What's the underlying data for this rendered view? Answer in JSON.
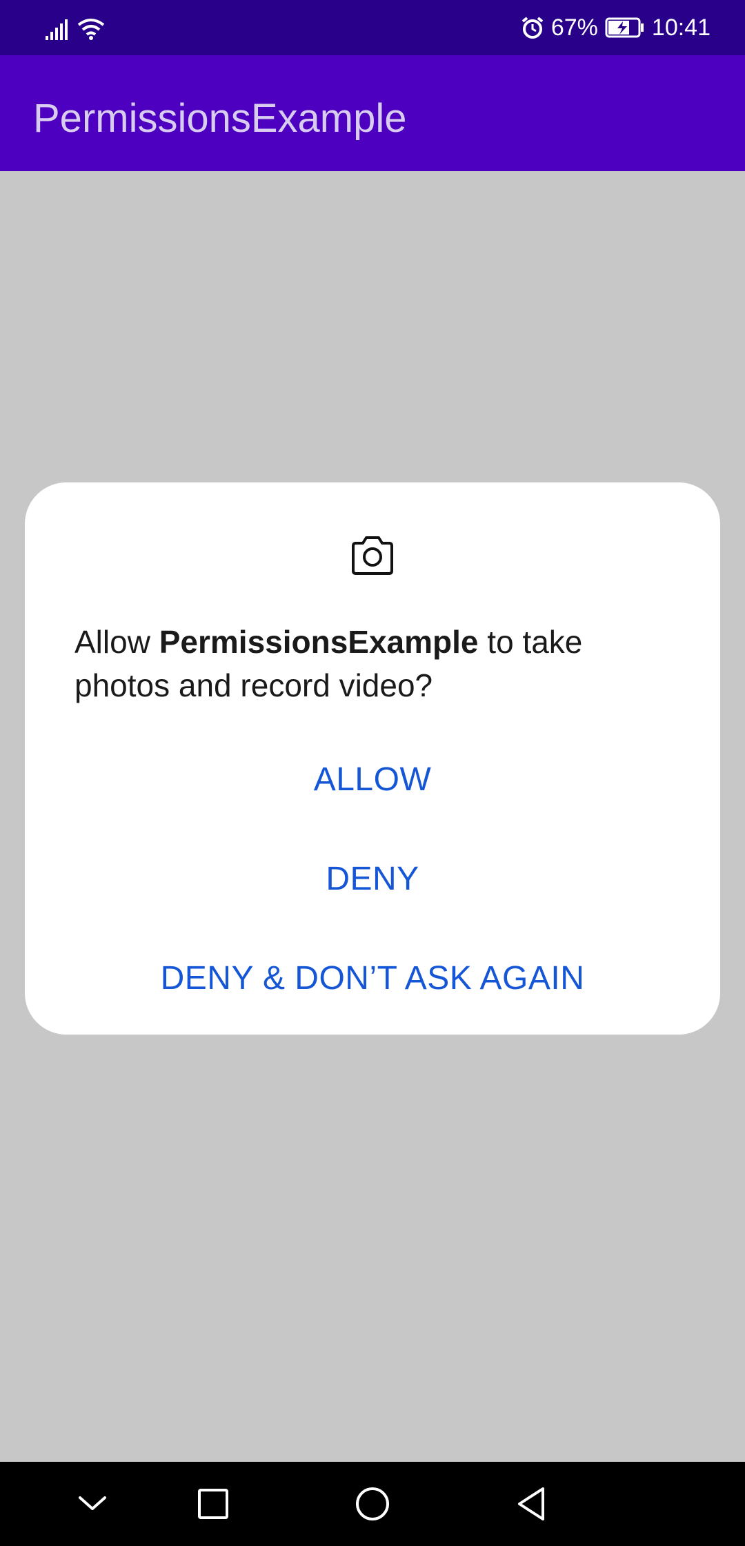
{
  "status_bar": {
    "battery_percent": "67%",
    "time": "10:41",
    "icons": [
      "signal-icon",
      "wifi-icon",
      "alarm-icon",
      "battery-charging-icon"
    ]
  },
  "app_bar": {
    "title": "PermissionsExample"
  },
  "dialog": {
    "icon": "camera-icon",
    "message_prefix": "Allow ",
    "app_name": "PermissionsExample",
    "message_suffix": " to take photos and record video?",
    "buttons": {
      "allow": "ALLOW",
      "deny": "DENY",
      "deny_never": "DENY & DON’T ASK AGAIN"
    }
  },
  "nav_bar": {
    "icons": [
      "chevron-down-icon",
      "recents-icon",
      "home-icon",
      "back-icon"
    ]
  },
  "colors": {
    "status_bar_bg": "#29008a",
    "app_bar_bg": "#4e00c0",
    "scrim": "#c7c7c7",
    "button_text": "#1556d6"
  }
}
